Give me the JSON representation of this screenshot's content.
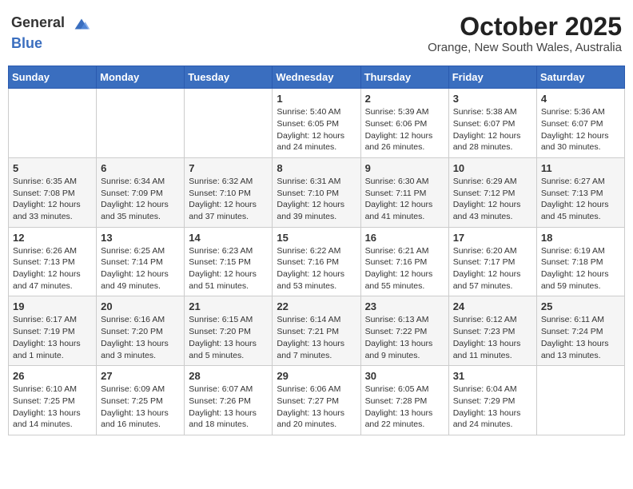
{
  "header": {
    "logo_general": "General",
    "logo_blue": "Blue",
    "month": "October 2025",
    "location": "Orange, New South Wales, Australia"
  },
  "weekdays": [
    "Sunday",
    "Monday",
    "Tuesday",
    "Wednesday",
    "Thursday",
    "Friday",
    "Saturday"
  ],
  "weeks": [
    [
      {
        "day": "",
        "content": ""
      },
      {
        "day": "",
        "content": ""
      },
      {
        "day": "",
        "content": ""
      },
      {
        "day": "1",
        "content": "Sunrise: 5:40 AM\nSunset: 6:05 PM\nDaylight: 12 hours\nand 24 minutes."
      },
      {
        "day": "2",
        "content": "Sunrise: 5:39 AM\nSunset: 6:06 PM\nDaylight: 12 hours\nand 26 minutes."
      },
      {
        "day": "3",
        "content": "Sunrise: 5:38 AM\nSunset: 6:07 PM\nDaylight: 12 hours\nand 28 minutes."
      },
      {
        "day": "4",
        "content": "Sunrise: 5:36 AM\nSunset: 6:07 PM\nDaylight: 12 hours\nand 30 minutes."
      }
    ],
    [
      {
        "day": "5",
        "content": "Sunrise: 6:35 AM\nSunset: 7:08 PM\nDaylight: 12 hours\nand 33 minutes."
      },
      {
        "day": "6",
        "content": "Sunrise: 6:34 AM\nSunset: 7:09 PM\nDaylight: 12 hours\nand 35 minutes."
      },
      {
        "day": "7",
        "content": "Sunrise: 6:32 AM\nSunset: 7:10 PM\nDaylight: 12 hours\nand 37 minutes."
      },
      {
        "day": "8",
        "content": "Sunrise: 6:31 AM\nSunset: 7:10 PM\nDaylight: 12 hours\nand 39 minutes."
      },
      {
        "day": "9",
        "content": "Sunrise: 6:30 AM\nSunset: 7:11 PM\nDaylight: 12 hours\nand 41 minutes."
      },
      {
        "day": "10",
        "content": "Sunrise: 6:29 AM\nSunset: 7:12 PM\nDaylight: 12 hours\nand 43 minutes."
      },
      {
        "day": "11",
        "content": "Sunrise: 6:27 AM\nSunset: 7:13 PM\nDaylight: 12 hours\nand 45 minutes."
      }
    ],
    [
      {
        "day": "12",
        "content": "Sunrise: 6:26 AM\nSunset: 7:13 PM\nDaylight: 12 hours\nand 47 minutes."
      },
      {
        "day": "13",
        "content": "Sunrise: 6:25 AM\nSunset: 7:14 PM\nDaylight: 12 hours\nand 49 minutes."
      },
      {
        "day": "14",
        "content": "Sunrise: 6:23 AM\nSunset: 7:15 PM\nDaylight: 12 hours\nand 51 minutes."
      },
      {
        "day": "15",
        "content": "Sunrise: 6:22 AM\nSunset: 7:16 PM\nDaylight: 12 hours\nand 53 minutes."
      },
      {
        "day": "16",
        "content": "Sunrise: 6:21 AM\nSunset: 7:16 PM\nDaylight: 12 hours\nand 55 minutes."
      },
      {
        "day": "17",
        "content": "Sunrise: 6:20 AM\nSunset: 7:17 PM\nDaylight: 12 hours\nand 57 minutes."
      },
      {
        "day": "18",
        "content": "Sunrise: 6:19 AM\nSunset: 7:18 PM\nDaylight: 12 hours\nand 59 minutes."
      }
    ],
    [
      {
        "day": "19",
        "content": "Sunrise: 6:17 AM\nSunset: 7:19 PM\nDaylight: 13 hours\nand 1 minute."
      },
      {
        "day": "20",
        "content": "Sunrise: 6:16 AM\nSunset: 7:20 PM\nDaylight: 13 hours\nand 3 minutes."
      },
      {
        "day": "21",
        "content": "Sunrise: 6:15 AM\nSunset: 7:20 PM\nDaylight: 13 hours\nand 5 minutes."
      },
      {
        "day": "22",
        "content": "Sunrise: 6:14 AM\nSunset: 7:21 PM\nDaylight: 13 hours\nand 7 minutes."
      },
      {
        "day": "23",
        "content": "Sunrise: 6:13 AM\nSunset: 7:22 PM\nDaylight: 13 hours\nand 9 minutes."
      },
      {
        "day": "24",
        "content": "Sunrise: 6:12 AM\nSunset: 7:23 PM\nDaylight: 13 hours\nand 11 minutes."
      },
      {
        "day": "25",
        "content": "Sunrise: 6:11 AM\nSunset: 7:24 PM\nDaylight: 13 hours\nand 13 minutes."
      }
    ],
    [
      {
        "day": "26",
        "content": "Sunrise: 6:10 AM\nSunset: 7:25 PM\nDaylight: 13 hours\nand 14 minutes."
      },
      {
        "day": "27",
        "content": "Sunrise: 6:09 AM\nSunset: 7:25 PM\nDaylight: 13 hours\nand 16 minutes."
      },
      {
        "day": "28",
        "content": "Sunrise: 6:07 AM\nSunset: 7:26 PM\nDaylight: 13 hours\nand 18 minutes."
      },
      {
        "day": "29",
        "content": "Sunrise: 6:06 AM\nSunset: 7:27 PM\nDaylight: 13 hours\nand 20 minutes."
      },
      {
        "day": "30",
        "content": "Sunrise: 6:05 AM\nSunset: 7:28 PM\nDaylight: 13 hours\nand 22 minutes."
      },
      {
        "day": "31",
        "content": "Sunrise: 6:04 AM\nSunset: 7:29 PM\nDaylight: 13 hours\nand 24 minutes."
      },
      {
        "day": "",
        "content": ""
      }
    ]
  ]
}
